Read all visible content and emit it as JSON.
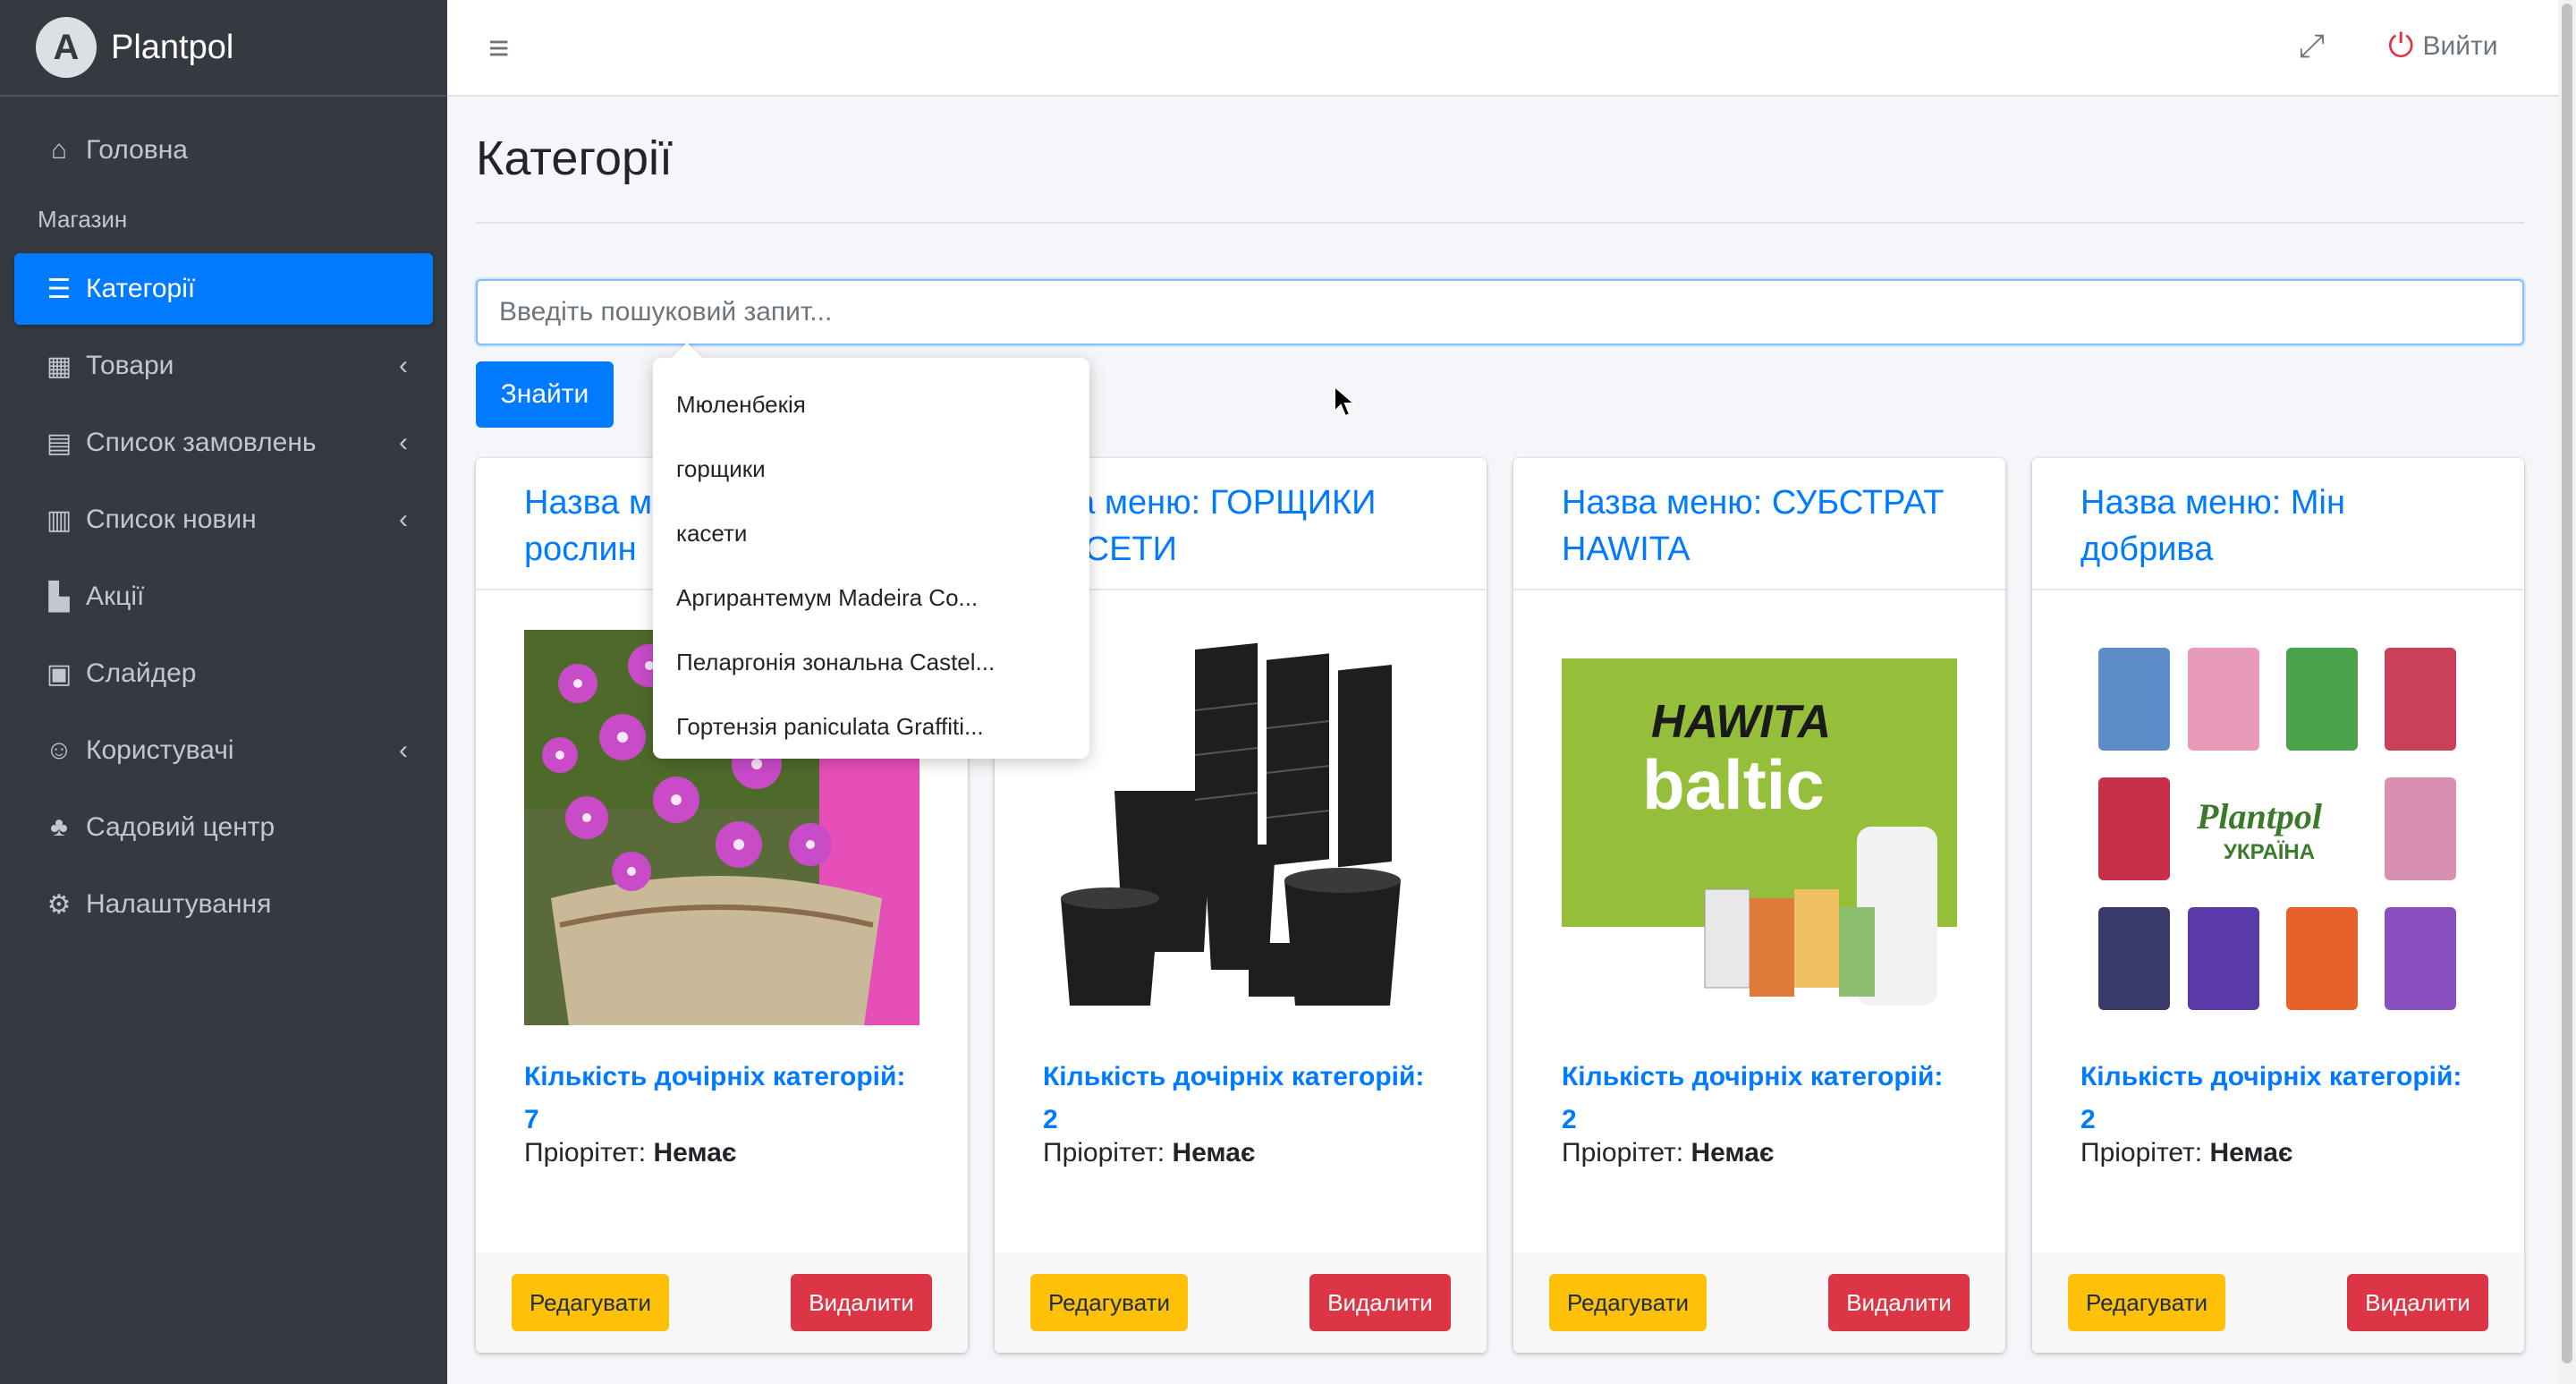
{
  "brand": {
    "name": "Plantpol",
    "logo_letter": "A"
  },
  "sidebar": {
    "section_header": "Магазин",
    "items": [
      {
        "label": "Головна",
        "icon": "home-icon",
        "glyph": "⌂",
        "has_arrow": false
      },
      {
        "label": "Категорії",
        "icon": "list-icon",
        "glyph": "☰",
        "active": true,
        "has_arrow": false
      },
      {
        "label": "Товари",
        "icon": "store-icon",
        "glyph": "▦",
        "has_arrow": true
      },
      {
        "label": "Список замовлень",
        "icon": "list-alt-icon",
        "glyph": "▤",
        "has_arrow": true
      },
      {
        "label": "Список новин",
        "icon": "newspaper-icon",
        "glyph": "▥",
        "has_arrow": true
      },
      {
        "label": "Акції",
        "icon": "city-icon",
        "glyph": "▙",
        "has_arrow": false
      },
      {
        "label": "Слайдер",
        "icon": "image-icon",
        "glyph": "▣",
        "has_arrow": false
      },
      {
        "label": "Користувачі",
        "icon": "users-icon",
        "glyph": "☺",
        "has_arrow": true
      },
      {
        "label": "Садовий центр",
        "icon": "seedling-icon",
        "glyph": "♣",
        "has_arrow": false
      },
      {
        "label": "Налаштування",
        "icon": "cog-icon",
        "glyph": "⚙",
        "has_arrow": false
      }
    ],
    "arrow_glyph": "‹"
  },
  "header": {
    "menu_glyph": "≡",
    "fullscreen_glyph": "⤢",
    "logout_glyph": "⏻",
    "logout_label": "Вийти"
  },
  "page": {
    "title": "Категорії",
    "search_placeholder": "Введіть пошуковий запит...",
    "search_button": "Знайти"
  },
  "autocomplete": [
    "Мюленбекія",
    "горщики",
    "касети",
    "Аргирантемум Madeira Co...",
    "Пеларгонія зональна Castel...",
    "Гортензія paniculata Graffiti..."
  ],
  "cards": [
    {
      "title": "Назва ме",
      "title2": "рослин",
      "children_label": "Кількість дочірніх категорій:",
      "children_count": "7",
      "priority_label": "Пріорітет:",
      "priority_value": "Немає",
      "edit": "Редагувати",
      "delete": "Видалити",
      "image": "flowers-image"
    },
    {
      "title": "зва меню: ГОРЩИКИ",
      "title2": "КАСЕТИ",
      "children_label": "Кількість дочірніх категорій:",
      "children_count": "2",
      "priority_label": "Пріорітет:",
      "priority_value": "Немає",
      "edit": "Редагувати",
      "delete": "Видалити",
      "image": "pots-image"
    },
    {
      "title": "Назва меню: СУБСТРАТ",
      "title2": "HAWITA",
      "children_label": "Кількість дочірніх категорій:",
      "children_count": "2",
      "priority_label": "Пріорітет:",
      "priority_value": "Немає",
      "edit": "Редагувати",
      "delete": "Видалити",
      "image": "hawita-image",
      "logo_text": "HAWITA",
      "logo_text2": "baltic"
    },
    {
      "title": "Назва меню: Мін",
      "title2": "добрива",
      "children_label": "Кількість дочірніх категорій:",
      "children_count": "2",
      "priority_label": "Пріорітет:",
      "priority_value": "Немає",
      "edit": "Редагувати",
      "delete": "Видалити",
      "image": "fertilizer-image",
      "logo_text": "Plantpol",
      "logo_text2": "УКРАЇНА"
    }
  ],
  "colors": {
    "primary": "#007bff",
    "warning": "#ffc107",
    "danger": "#dc3545",
    "sidebar": "#343a40"
  }
}
